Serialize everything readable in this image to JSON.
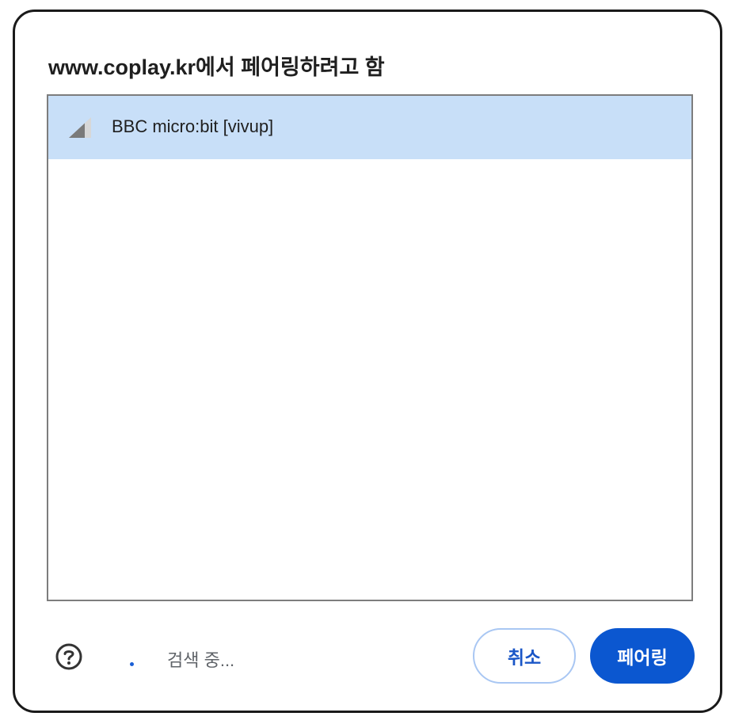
{
  "dialog": {
    "title": "www.coplay.kr에서 페어링하려고 함",
    "devices": [
      {
        "name": "BBC micro:bit [vivup]",
        "selected": true,
        "icon": "signal-strength-icon"
      }
    ],
    "status_text": "검색 중...",
    "buttons": {
      "cancel_label": "취소",
      "pair_label": "페어링"
    },
    "icons": {
      "help": "help-circle-icon",
      "spinner": "loading-spinner-icon"
    },
    "colors": {
      "selected_row": "#c8dff8",
      "primary": "#0b57d0",
      "cancel_border": "#a9c7f3"
    }
  }
}
